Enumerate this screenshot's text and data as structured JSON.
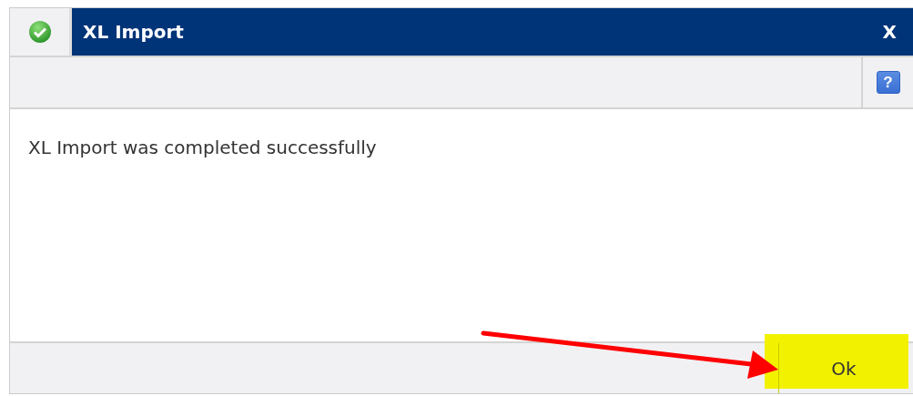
{
  "window": {
    "title": "XL Import",
    "close": "X"
  },
  "toolbar": {
    "help": "?"
  },
  "message": "XL Import was completed successfully",
  "buttons": [
    {
      "label": "Ok",
      "highlighted": true
    }
  ]
}
